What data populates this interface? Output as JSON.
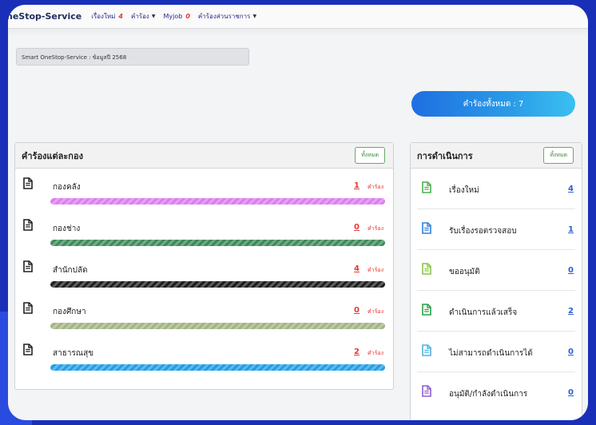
{
  "navbar": {
    "brand": "neStop-Service",
    "items": [
      {
        "label": "เรื่องใหม่",
        "count": "4",
        "caret": false
      },
      {
        "label": "คำร้อง",
        "count": "",
        "caret": true
      },
      {
        "label": "Myjob",
        "count": "0",
        "caret": false
      },
      {
        "label": "คำร้องส่วนราชการ",
        "count": "",
        "caret": true
      }
    ]
  },
  "info_bar": "Smart OneStop-Service : ข้อมูลปี 2568",
  "total_pill": "คำร้องทั้งหมด : 7",
  "left_panel": {
    "title": "คำร้องแต่ละกอง",
    "all_button": "ทั้งหมด",
    "unit_label": "คำร้อง",
    "rows": [
      {
        "label": "กองคลัง",
        "count": "1",
        "bar_color": "#dc7cf0"
      },
      {
        "label": "กองช่าง",
        "count": "0",
        "bar_color": "#3d8a57"
      },
      {
        "label": "สำนักปลัด",
        "count": "4",
        "bar_color": "#1d1d1d"
      },
      {
        "label": "กองศึกษา",
        "count": "0",
        "bar_color": "#a3b483"
      },
      {
        "label": "สาธารณสุข",
        "count": "2",
        "bar_color": "#1f9ee6"
      }
    ]
  },
  "right_panel": {
    "title": "การดำเนินการ",
    "all_button": "ทั้งหมด",
    "rows": [
      {
        "label": "เรื่องใหม่",
        "count": "4",
        "icon_color": "#4caf50"
      },
      {
        "label": "รับเรื่องรอตรวจสอบ",
        "count": "1",
        "icon_color": "#2f7fe0"
      },
      {
        "label": "ขออนุมัติ",
        "count": "0",
        "icon_color": "#8bc34a"
      },
      {
        "label": "ดำเนินการแล้วเสร็จ",
        "count": "2",
        "icon_color": "#27a046"
      },
      {
        "label": "ไม่สามารถดำเนินการได้",
        "count": "0",
        "icon_color": "#4fb0e0"
      },
      {
        "label": "อนุมัติ/กำลังดำเนินการ",
        "count": "0",
        "icon_color": "#8e5fd0"
      }
    ]
  }
}
